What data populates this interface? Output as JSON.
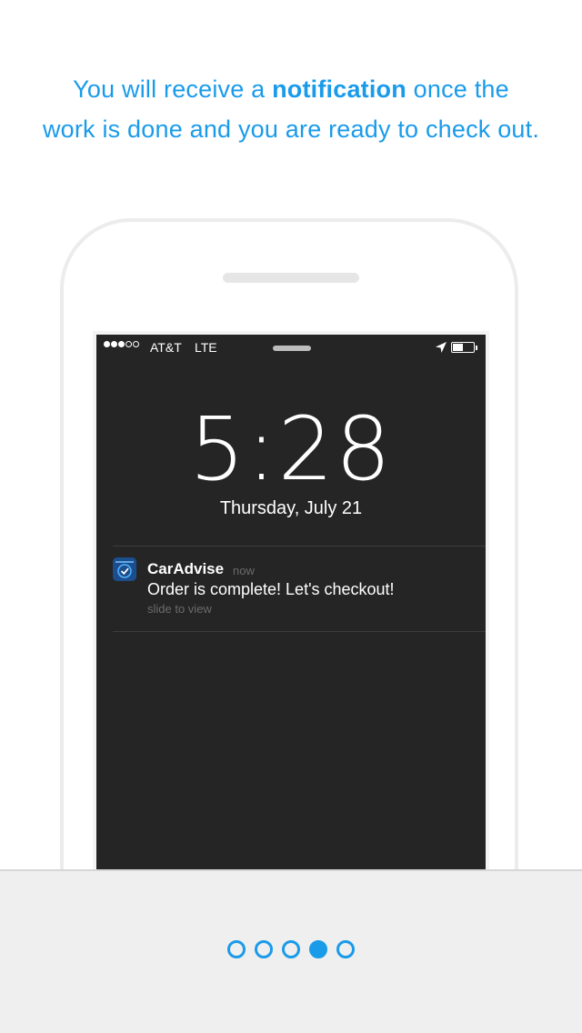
{
  "headline": {
    "line1_before": "You will receive a ",
    "line1_bold": "notification",
    "line1_after": " once the",
    "line2": "work is done and you are ready to check out."
  },
  "status_bar": {
    "signal_bars": 3,
    "signal_total": 5,
    "carrier": "AT&T",
    "network": "LTE",
    "battery_level_fraction": 0.5
  },
  "lock_screen": {
    "time": "5:28",
    "date": "Thursday, July 21"
  },
  "notification": {
    "app_icon": "caradvise-app-icon",
    "app_name": "CarAdvise",
    "timestamp": "now",
    "message": "Order is complete! Let's checkout!",
    "hint": "slide to view"
  },
  "pager": {
    "total_pages": 5,
    "active_index": 3
  },
  "colors": {
    "accent": "#1a9bea",
    "lock_background": "#252525",
    "footer_background": "#efefef"
  }
}
